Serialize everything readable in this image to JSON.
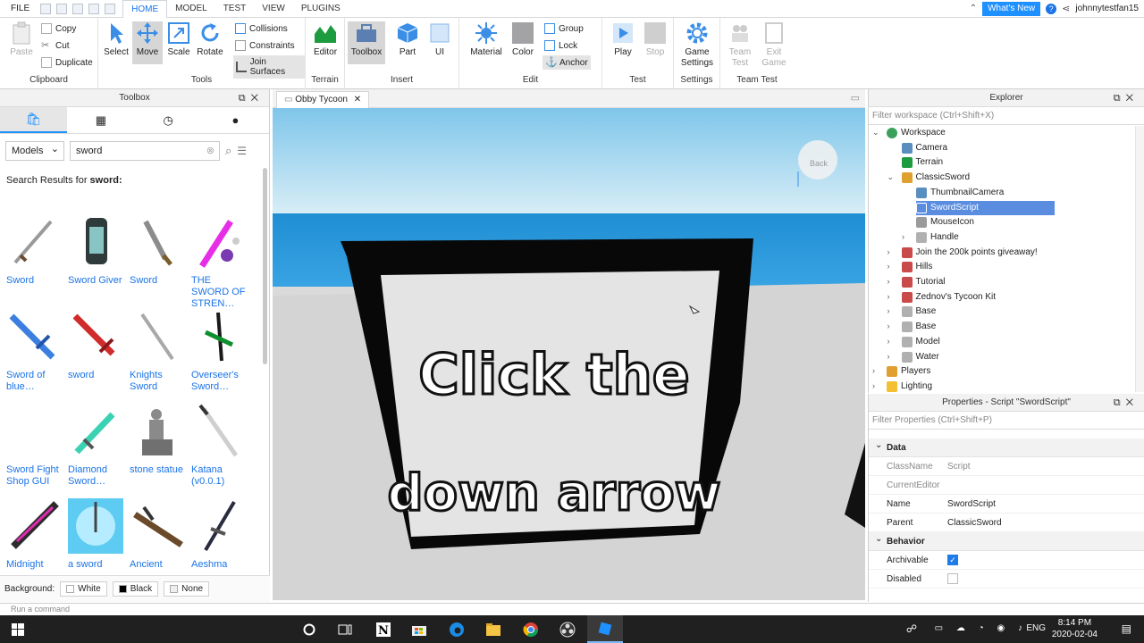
{
  "menubar": {
    "file": "FILE",
    "tabs": [
      "HOME",
      "MODEL",
      "TEST",
      "VIEW",
      "PLUGINS"
    ],
    "whats_new": "What's New",
    "username": "johnnytestfan15"
  },
  "ribbon": {
    "clipboard": {
      "label": "Clipboard",
      "paste": "Paste",
      "copy": "Copy",
      "cut": "Cut",
      "duplicate": "Duplicate"
    },
    "tools": {
      "label": "Tools",
      "select": "Select",
      "move": "Move",
      "scale": "Scale",
      "rotate": "Rotate",
      "collisions": "Collisions",
      "constraints": "Constraints",
      "join_surfaces": "Join Surfaces"
    },
    "terrain": {
      "label": "Terrain",
      "editor": "Editor"
    },
    "insert": {
      "label": "Insert",
      "toolbox": "Toolbox",
      "part": "Part",
      "ui": "UI"
    },
    "edit": {
      "label": "Edit",
      "material": "Material",
      "color": "Color",
      "group": "Group",
      "lock": "Lock",
      "anchor": "Anchor"
    },
    "test": {
      "label": "Test",
      "play": "Play",
      "stop": "Stop"
    },
    "settings": {
      "label": "Settings",
      "game_settings_1": "Game",
      "game_settings_2": "Settings"
    },
    "team_test": {
      "label": "Team Test",
      "team_test_1": "Team",
      "team_test_2": "Test",
      "exit_game_1": "Exit",
      "exit_game_2": "Game"
    }
  },
  "toolbox": {
    "title": "Toolbox",
    "category": "Models",
    "search_value": "sword",
    "results_prefix": "Search Results for ",
    "results_query": "sword:",
    "items": [
      {
        "name": "Sword"
      },
      {
        "name": "Sword Giver"
      },
      {
        "name": "Sword"
      },
      {
        "name": "THE SWORD OF STREN…"
      },
      {
        "name": "Sword of blue…"
      },
      {
        "name": "sword"
      },
      {
        "name": "Knights Sword"
      },
      {
        "name": "Overseer's Sword…"
      },
      {
        "name": "Sword Fight Shop GUI"
      },
      {
        "name": "Diamond Sword…"
      },
      {
        "name": "stone statue"
      },
      {
        "name": "Katana (v0.0.1)"
      },
      {
        "name": "Midnight"
      },
      {
        "name": "a sword"
      },
      {
        "name": "Ancient"
      },
      {
        "name": "Aeshma"
      }
    ],
    "background_label": "Background:",
    "bg_white": "White",
    "bg_black": "Black",
    "bg_none": "None"
  },
  "viewport": {
    "tab": "Obby Tycoon",
    "sign_line1": "Click the",
    "sign_line2": "down arrow",
    "view_cube_label": "Back"
  },
  "explorer": {
    "title": "Explorer",
    "filter_placeholder": "Filter workspace (Ctrl+Shift+X)",
    "items": [
      "Workspace",
      "Camera",
      "Terrain",
      "ClassicSword",
      "ThumbnailCamera",
      "SwordScript",
      "MouseIcon",
      "Handle",
      "Join the 200k points giveaway!",
      "Hills",
      "Tutorial",
      "Zednov's Tycoon Kit",
      "Base",
      "Base",
      "Model",
      "Water",
      "Players",
      "Lighting"
    ]
  },
  "properties": {
    "title": "Properties - Script \"SwordScript\"",
    "filter_placeholder": "Filter Properties (Ctrl+Shift+P)",
    "section_data": "Data",
    "section_behavior": "Behavior",
    "rows": [
      {
        "k": "ClassName",
        "v": "Script"
      },
      {
        "k": "CurrentEditor",
        "v": ""
      },
      {
        "k": "Name",
        "v": "SwordScript"
      },
      {
        "k": "Parent",
        "v": "ClassicSword"
      }
    ],
    "archivable": "Archivable",
    "disabled": "Disabled",
    "archivable_checked": true,
    "disabled_checked": false
  },
  "command_bar": {
    "placeholder": "Run a command"
  },
  "taskbar": {
    "lang": "ENG",
    "time": "8:14 PM",
    "date": "2020-02-04"
  }
}
